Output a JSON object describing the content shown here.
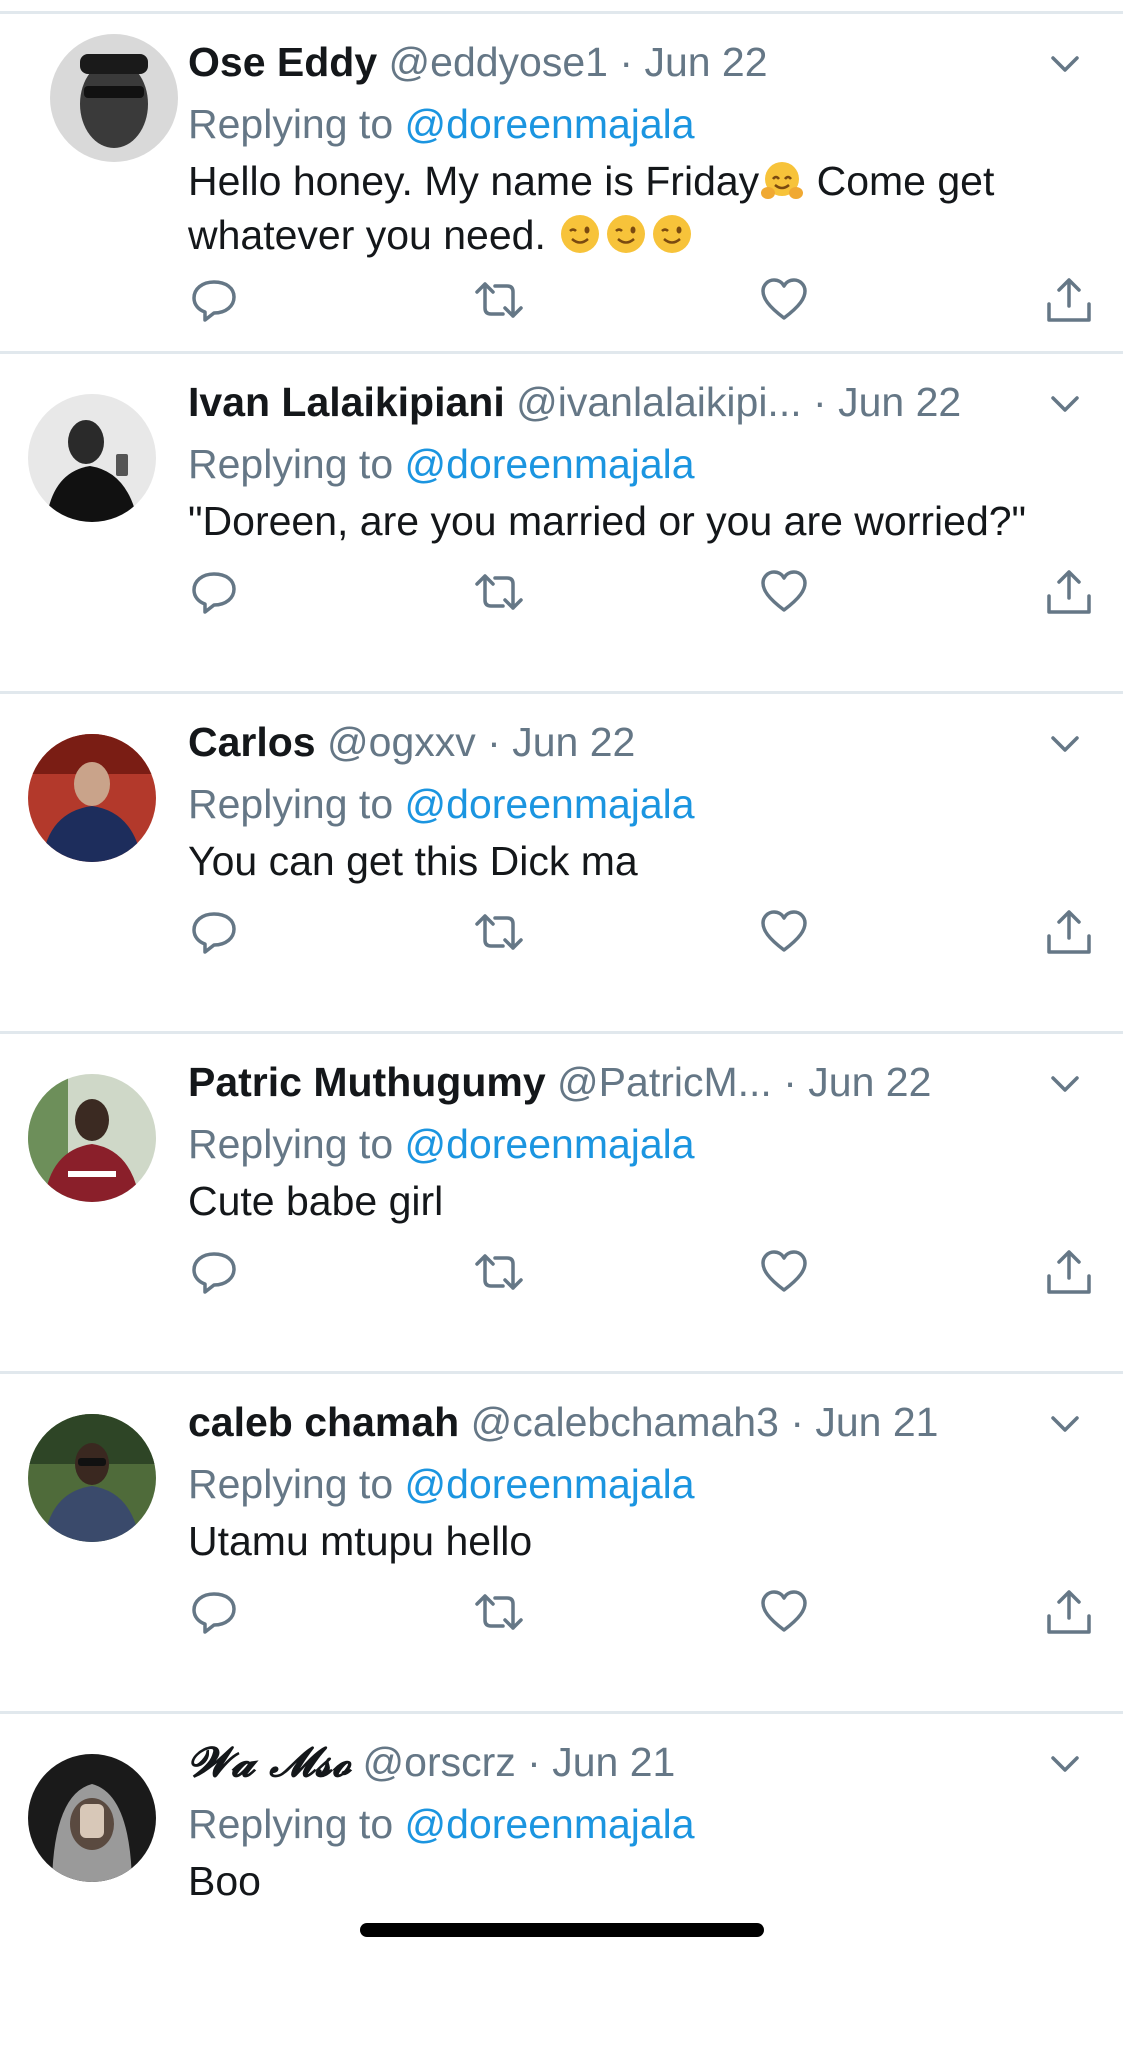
{
  "tweets": [
    {
      "name": "Ose Eddy",
      "handle": "@eddyose1",
      "sep": "·",
      "date": "Jun 22",
      "replying_prefix": "Replying to",
      "mention": "@doreenmajala",
      "text_part1": "Hello honey. My name is Friday",
      "text_part2": " Come get whatever you need. ",
      "emojis": [
        "hugging-face",
        "winking-face",
        "winking-face",
        "winking-face"
      ]
    },
    {
      "name": "Ivan Lalaikipiani",
      "handle": "@ivanlalaikipi...",
      "sep": "·",
      "date": "Jun 22",
      "replying_prefix": "Replying to",
      "mention": "@doreenmajala",
      "text": "\"Doreen, are you married or you are worried?\""
    },
    {
      "name": "Carlos",
      "handle": "@ogxxv",
      "sep": "·",
      "date": "Jun 22",
      "replying_prefix": "Replying to",
      "mention": "@doreenmajala",
      "text": "You can get this Dick ma"
    },
    {
      "name": "Patric Muthugumy",
      "handle": "@PatricM...",
      "sep": "·",
      "date": "Jun 22",
      "replying_prefix": "Replying to",
      "mention": "@doreenmajala",
      "text": "Cute babe girl"
    },
    {
      "name": "caleb chamah",
      "handle": "@calebchamah3",
      "sep": "·",
      "date": "Jun 21",
      "replying_prefix": "Replying to",
      "mention": "@doreenmajala",
      "text": "Utamu mtupu hello"
    },
    {
      "name": "𝓦𝓪 𝓜𝓼𝓸",
      "handle": "@orscrz",
      "sep": "·",
      "date": "Jun 21",
      "replying_prefix": "Replying to",
      "mention": "@doreenmajala",
      "text": "Boo"
    }
  ],
  "icons": {
    "reply": "reply-icon",
    "retweet": "retweet-icon",
    "like": "heart-icon",
    "share": "share-icon",
    "caret": "chevron-down-icon"
  },
  "colors": {
    "text": "#14171a",
    "secondary": "#657786",
    "link": "#1b95e0",
    "divider": "#e1e8ed",
    "icon": "#657786"
  }
}
